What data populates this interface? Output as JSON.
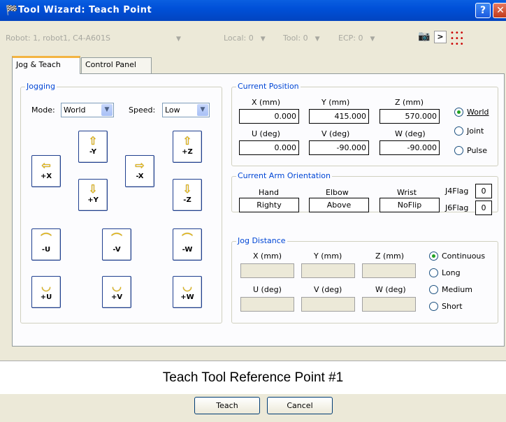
{
  "window": {
    "title": "Tool Wizard: Teach Point",
    "help_label": "?",
    "close_label": "✕"
  },
  "toolbar": {
    "robot": "Robot: 1, robot1, C4-A601S",
    "local": "Local: 0",
    "tool": "Tool: 0",
    "ecp": "ECP: 0",
    "dropdown_glyph": "▼"
  },
  "tabs": [
    {
      "label": "Jog & Teach"
    },
    {
      "label": "Control Panel"
    }
  ],
  "jogging": {
    "title": "Jogging",
    "mode_label": "Mode:",
    "mode_value": "World",
    "speed_label": "Speed:",
    "speed_value": "Low",
    "buttons": {
      "mx": {
        "label": "+X",
        "icon": "⇦"
      },
      "my_n": {
        "label": "-Y",
        "icon": "⇧"
      },
      "py": {
        "label": "+Y",
        "icon": "⇩"
      },
      "nx": {
        "label": "-X",
        "icon": "⇨"
      },
      "pz": {
        "label": "+Z",
        "icon": "⇧"
      },
      "nz": {
        "label": "-Z",
        "icon": "⇩"
      },
      "nu": {
        "label": "-U",
        "icon": "⌒"
      },
      "nv": {
        "label": "-V",
        "icon": "⌒"
      },
      "nw": {
        "label": "-W",
        "icon": "⌒"
      },
      "pu": {
        "label": "+U",
        "icon": "◡"
      },
      "pv": {
        "label": "+V",
        "icon": "◡"
      },
      "pw": {
        "label": "+W",
        "icon": "◡"
      }
    }
  },
  "current_position": {
    "title": "Current Position",
    "x_label": "X (mm)",
    "y_label": "Y (mm)",
    "z_label": "Z (mm)",
    "u_label": "U (deg)",
    "v_label": "V (deg)",
    "w_label": "W (deg)",
    "x": "0.000",
    "y": "415.000",
    "z": "570.000",
    "u": "0.000",
    "v": "-90.000",
    "w": "-90.000",
    "modes": [
      "World",
      "Joint",
      "Pulse"
    ],
    "selected": "World"
  },
  "orientation": {
    "title": "Current Arm Orientation",
    "hand_label": "Hand",
    "elbow_label": "Elbow",
    "wrist_label": "Wrist",
    "hand": "Righty",
    "elbow": "Above",
    "wrist": "NoFlip",
    "j4_label": "J4Flag",
    "j4": "0",
    "j6_label": "J6Flag",
    "j6": "0"
  },
  "jog_distance": {
    "title": "Jog Distance",
    "x_label": "X (mm)",
    "y_label": "Y (mm)",
    "z_label": "Z (mm)",
    "u_label": "U (deg)",
    "v_label": "V (deg)",
    "w_label": "W (deg)",
    "modes": [
      "Continuous",
      "Long",
      "Medium",
      "Short"
    ],
    "selected": "Continuous"
  },
  "status": {
    "text": "Teach Tool Reference Point #1"
  },
  "buttons": {
    "teach": "Teach",
    "cancel": "Cancel"
  },
  "colors": {
    "titlebar": "#0050d8",
    "group_label": "#0046d5",
    "tab_highlight": "#f3b442"
  }
}
